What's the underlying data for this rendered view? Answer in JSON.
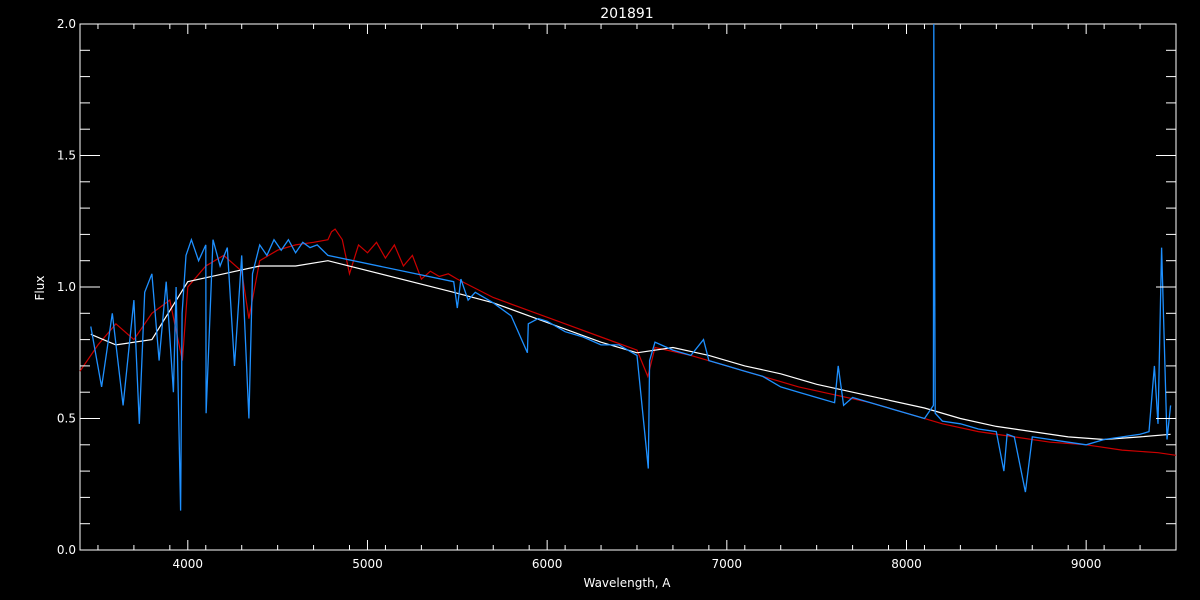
{
  "chart_data": {
    "type": "line",
    "title": "201891",
    "xlabel": "Wavelength, A",
    "ylabel": "Flux",
    "xlim": [
      3400,
      9500
    ],
    "ylim": [
      0.0,
      2.0
    ],
    "x_ticks": [
      4000,
      5000,
      6000,
      7000,
      8000,
      9000
    ],
    "x_tick_labels": [
      "4000",
      "5000",
      "6000",
      "7000",
      "8000",
      "9000"
    ],
    "y_ticks": [
      0.0,
      0.5,
      1.0,
      1.5,
      2.0
    ],
    "y_tick_labels": [
      "0.0",
      "0.5",
      "1.0",
      "1.5",
      "2.0"
    ],
    "grid": false,
    "colors": {
      "background": "#000000",
      "axes": "#ffffff",
      "observed": "#1e90ff",
      "model": "#cc0000",
      "white_trace": "#ffffff"
    },
    "series": [
      {
        "color": "#cc0000",
        "x": [
          3400,
          3500,
          3600,
          3700,
          3800,
          3900,
          3970,
          4000,
          4100,
          4200,
          4300,
          4340,
          4400,
          4500,
          4600,
          4700,
          4780,
          4800,
          4820,
          4860,
          4900,
          4950,
          5000,
          5050,
          5100,
          5150,
          5200,
          5250,
          5300,
          5350,
          5400,
          5450,
          5500,
          5700,
          5900,
          6100,
          6300,
          6500,
          6560,
          6600,
          6800,
          7000,
          7200,
          7400,
          7600,
          7800,
          8000,
          8200,
          8400,
          8600,
          8800,
          9000,
          9200,
          9400,
          9500
        ],
        "y": [
          0.68,
          0.78,
          0.86,
          0.8,
          0.9,
          0.95,
          0.72,
          1.0,
          1.08,
          1.12,
          1.06,
          0.88,
          1.1,
          1.14,
          1.16,
          1.17,
          1.18,
          1.21,
          1.22,
          1.18,
          1.05,
          1.16,
          1.13,
          1.17,
          1.11,
          1.16,
          1.08,
          1.12,
          1.03,
          1.06,
          1.04,
          1.05,
          1.03,
          0.96,
          0.91,
          0.86,
          0.81,
          0.76,
          0.66,
          0.77,
          0.74,
          0.7,
          0.66,
          0.62,
          0.59,
          0.56,
          0.52,
          0.48,
          0.45,
          0.43,
          0.41,
          0.4,
          0.38,
          0.37,
          0.36
        ]
      },
      {
        "color": "#ffffff",
        "x": [
          3460,
          3600,
          3800,
          4000,
          4200,
          4400,
          4600,
          4780,
          5480,
          5700,
          5900,
          6100,
          6300,
          6500,
          6700,
          6900,
          7100,
          7300,
          7500,
          7700,
          7900,
          8100,
          8300,
          8500,
          8700,
          8900,
          9100,
          9300,
          9470
        ],
        "y": [
          0.82,
          0.78,
          0.8,
          1.02,
          1.05,
          1.08,
          1.08,
          1.1,
          0.98,
          0.94,
          0.89,
          0.84,
          0.79,
          0.75,
          0.77,
          0.74,
          0.7,
          0.67,
          0.63,
          0.6,
          0.57,
          0.54,
          0.5,
          0.47,
          0.45,
          0.43,
          0.42,
          0.43,
          0.44
        ]
      },
      {
        "color": "#1e90ff",
        "x": [
          3460,
          3520,
          3580,
          3640,
          3700,
          3730,
          3760,
          3800,
          3840,
          3880,
          3920,
          3935,
          3960,
          3968,
          3990,
          4020,
          4060,
          4100,
          4102,
          4140,
          4180,
          4220,
          4260,
          4300,
          4340,
          4360,
          4400,
          4440,
          4480,
          4520,
          4560,
          4600,
          4640,
          4680,
          4720,
          4780,
          5480,
          5500,
          5520,
          5560,
          5600,
          5700,
          5800,
          5890,
          5895,
          5950,
          6000,
          6100,
          6200,
          6300,
          6400,
          6500,
          6563,
          6570,
          6600,
          6700,
          6800,
          6870,
          6900,
          7000,
          7100,
          7200,
          7300,
          7400,
          7500,
          7600,
          7620,
          7650,
          7700,
          7800,
          7900,
          8000,
          8100,
          8150,
          8152,
          8160,
          8200,
          8300,
          8400,
          8500,
          8542,
          8560,
          8600,
          8662,
          8700,
          8800,
          8900,
          9000,
          9100,
          9200,
          9300,
          9350,
          9380,
          9400,
          9420,
          9450,
          9470
        ],
        "y": [
          0.85,
          0.62,
          0.9,
          0.55,
          0.95,
          0.48,
          0.98,
          1.05,
          0.72,
          1.02,
          0.6,
          1.0,
          0.15,
          0.9,
          1.12,
          1.18,
          1.1,
          1.16,
          0.52,
          1.18,
          1.08,
          1.15,
          0.7,
          1.12,
          0.5,
          1.05,
          1.16,
          1.12,
          1.18,
          1.14,
          1.18,
          1.13,
          1.17,
          1.15,
          1.16,
          1.12,
          1.02,
          0.92,
          1.03,
          0.95,
          0.98,
          0.94,
          0.89,
          0.75,
          0.86,
          0.88,
          0.87,
          0.83,
          0.81,
          0.78,
          0.78,
          0.74,
          0.31,
          0.72,
          0.79,
          0.76,
          0.74,
          0.8,
          0.72,
          0.7,
          0.68,
          0.66,
          0.62,
          0.6,
          0.58,
          0.56,
          0.7,
          0.55,
          0.58,
          0.56,
          0.54,
          0.52,
          0.5,
          0.55,
          2.0,
          0.52,
          0.49,
          0.48,
          0.46,
          0.45,
          0.3,
          0.44,
          0.43,
          0.22,
          0.43,
          0.42,
          0.41,
          0.4,
          0.42,
          0.43,
          0.44,
          0.45,
          0.7,
          0.48,
          1.15,
          0.42,
          0.55
        ]
      }
    ]
  }
}
